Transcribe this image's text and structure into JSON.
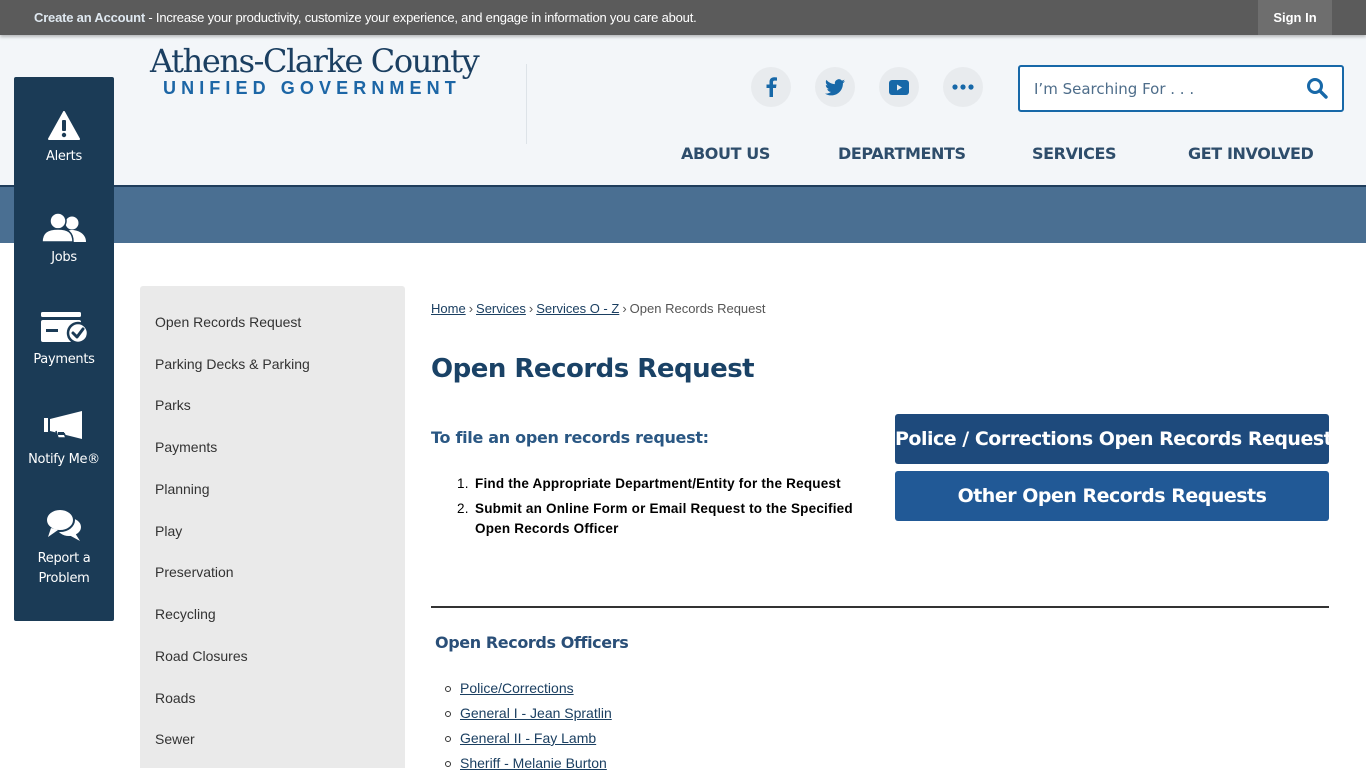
{
  "topbar": {
    "create_account_link": "Create an Account",
    "message": " - Increase your productivity, customize your experience, and engage in information you care about.",
    "sign_in": "Sign In"
  },
  "header": {
    "logo_line1": "Athens-Clarke County",
    "logo_line2": "UNIFIED GOVERNMENT",
    "social": [
      {
        "name": "facebook",
        "icon": "facebook-icon"
      },
      {
        "name": "twitter",
        "icon": "twitter-icon"
      },
      {
        "name": "youtube",
        "icon": "youtube-icon"
      },
      {
        "name": "more",
        "icon": "more-icon"
      }
    ],
    "search_placeholder": "I’m Searching For . . .",
    "search_value": "",
    "nav": [
      "ABOUT US",
      "DEPARTMENTS",
      "SERVICES",
      "GET INVOLVED"
    ]
  },
  "quick_links": [
    {
      "label": "Alerts",
      "icon": "alert-icon"
    },
    {
      "label": "Jobs",
      "icon": "jobs-icon"
    },
    {
      "label": "Payments",
      "icon": "payments-icon"
    },
    {
      "label": "Notify Me®",
      "icon": "megaphone-icon"
    },
    {
      "label": "Report a Problem",
      "icon": "chat-bubbles-icon"
    }
  ],
  "sidenav": {
    "items": [
      "Open Records Request",
      "Parking Decks & Parking",
      "Parks",
      "Payments",
      "Planning",
      "Play",
      "Preservation",
      "Recycling",
      "Road Closures",
      "Roads",
      "Sewer"
    ]
  },
  "breadcrumb": {
    "items": [
      "Home",
      "Services",
      "Services O - Z"
    ],
    "separator": "›",
    "current": "Open Records Request"
  },
  "content": {
    "title": "Open Records Request",
    "subhead": "To file an open records request:",
    "steps": [
      "Find the Appropriate Department/Entity for the Request",
      "Submit an Online Form or Email Request to the Specified Open Records Officer"
    ],
    "buttons": {
      "police": "Police / Corrections Open Records Requests",
      "other": "Other Open Records Requests"
    },
    "officers_title": "Open Records Officers",
    "officers": [
      "Police/Corrections",
      "General I - Jean Spratlin",
      "General II - Fay Lamb",
      "Sheriff - Melanie Burton"
    ]
  },
  "colors": {
    "topbar": "#5b5b5b",
    "header_bg": "#f3f6f9",
    "banner": "#4a6f92",
    "quick_links_bg": "#1b3b56",
    "brand_dark": "#1a4266",
    "brand_blue": "#1768a8",
    "button_police": "#1e4a7c",
    "button_other": "#215996",
    "sidenav_bg": "#eaeaea"
  }
}
